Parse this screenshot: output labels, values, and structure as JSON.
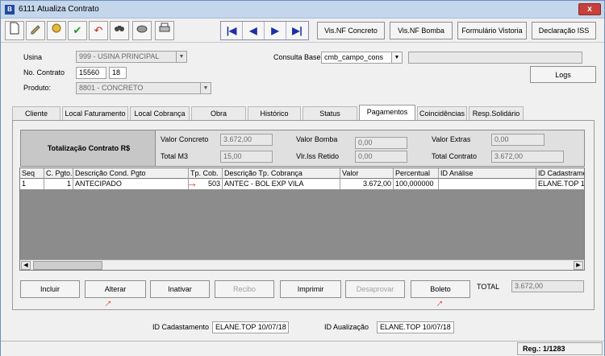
{
  "window": {
    "title": "6111 Atualiza Contrato",
    "close_label": "x"
  },
  "toolbar": {
    "icons": [
      "new-icon",
      "edit-icon",
      "delete-icon",
      "confirm-icon",
      "undo-icon",
      "search-icon",
      "tools-icon",
      "print-icon"
    ],
    "nav": {
      "first": "|◀",
      "prev": "◀",
      "next": "▶",
      "last": "▶|"
    },
    "buttons": [
      "Vis.NF Concreto",
      "Vis.NF Bomba",
      "Formulário Vistoria",
      "Declaração ISS"
    ]
  },
  "header": {
    "usina_label": "Usina",
    "usina_value": "999 - USINA PRINCIPAL",
    "contrato_label": "No. Contrato",
    "contrato_number": "15560",
    "contrato_suffix": "18",
    "produto_label": "Produto:",
    "produto_value": "8801 - CONCRETO",
    "consulta_label": "Consulta Base",
    "consulta_value": "cmb_campo_cons",
    "consulta_extra": "",
    "logs_label": "Logs"
  },
  "tabs": [
    "Cliente",
    "Local Faturamento",
    "Local Cobrança",
    "Obra",
    "Histórico",
    "Status",
    "Pagamentos",
    "Coincidências",
    "Resp.Solidário"
  ],
  "active_tab": "Pagamentos",
  "totals": {
    "title": "Totalização Contrato R$",
    "valor_concreto_label": "Valor Concreto",
    "valor_concreto": "3.672,00",
    "valor_bomba_label": "Valor Bomba",
    "valor_bomba": "0,00",
    "valor_extras_label": "Valor Extras",
    "valor_extras": "0,00",
    "total_m3_label": "Total M3",
    "total_m3": "15,00",
    "vlr_iss_label": "Vlr.Iss Retido",
    "vlr_iss": "0,00",
    "total_contrato_label": "Total Contrato",
    "total_contrato": "3.672,00"
  },
  "grid": {
    "columns": [
      "Seq",
      "C. Pgto.",
      "Descrição Cond. Pgto",
      "Tp. Cob.",
      "Descrição Tp. Cobrança",
      "Valor",
      "Percentual",
      "ID Análise",
      "ID Cadastrame"
    ],
    "rows": [
      [
        "1",
        "1",
        "ANTECIPADO",
        "503",
        "ANTEC - BOL EXP VILA",
        "3.672,00",
        "100,000000",
        "",
        "ELANE.TOP 1"
      ]
    ],
    "scroll_left": "◀",
    "scroll_right": "▶"
  },
  "actions": {
    "incluir": "Incluir",
    "alterar": "Alterar",
    "inativar": "Inativar",
    "recibo": "Recibo",
    "imprimir": "Imprimir",
    "desaprovar": "Desaprovar",
    "boleto": "Boleto",
    "total_label": "TOTAL",
    "total_value": "3.672,00"
  },
  "footer": {
    "id_cadastramento_label": "ID Cadastamento",
    "id_cadastramento": "ELANE.TOP 10/07/18",
    "id_atualizacao_label": "ID Aualização",
    "id_atualizacao": "ELANE.TOP 10/07/18"
  },
  "status": {
    "record": "Reg.: 1/1283"
  },
  "colors": {
    "accent_arrow": "#e4312a",
    "nav_blue": "#1c2fa8"
  }
}
